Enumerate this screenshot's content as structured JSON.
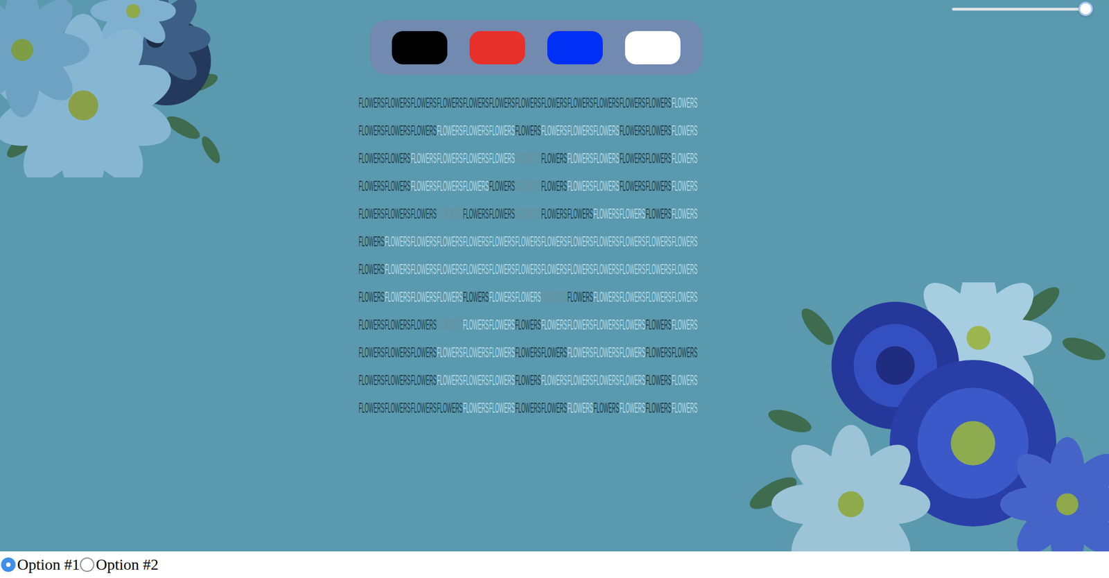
{
  "slider": {
    "level": 1.0
  },
  "palette": {
    "swatches": [
      {
        "color": "#000000"
      },
      {
        "color": "#e8302a"
      },
      {
        "color": "#0030f5"
      },
      {
        "color": "#ffffff"
      }
    ]
  },
  "grid": {
    "rows": [
      {
        "cells": [
          {
            "text": "FLOWERS",
            "color": "#1e3b47"
          },
          {
            "text": "FLOWERS",
            "color": "#1e3b47"
          },
          {
            "text": "FLOWERS",
            "color": "#1e3b47"
          },
          {
            "text": "FLOWERS",
            "color": "#1e3b47"
          },
          {
            "text": "FLOWERS",
            "color": "#1e3b47"
          },
          {
            "text": "FLOWERS",
            "color": "#1e3b47"
          },
          {
            "text": "FLOWERS",
            "color": "#1e3b47"
          },
          {
            "text": "FLOWERS",
            "color": "#1e3b47"
          },
          {
            "text": "FLOWERS",
            "color": "#1e3b47"
          },
          {
            "text": "FLOWERS",
            "color": "#1e3b47"
          },
          {
            "text": "FLOWERS",
            "color": "#1e3b47"
          },
          {
            "text": "FLOWERS",
            "color": "#1e3b47"
          },
          {
            "text": "FLOWERS",
            "color": "#b7dbe6"
          }
        ]
      },
      {
        "cells": [
          {
            "text": "FLOWERS",
            "color": "#1e3b47"
          },
          {
            "text": "FLOWERS",
            "color": "#1e3b47"
          },
          {
            "text": "FLOWERS",
            "color": "#1e3b47"
          },
          {
            "text": "FLOWERS",
            "color": "#b7dbe6"
          },
          {
            "text": "FLOWERS",
            "color": "#b7dbe6"
          },
          {
            "text": "FLOWERS",
            "color": "#b7dbe6"
          },
          {
            "text": "FLOWERS",
            "color": "#1e3b47"
          },
          {
            "text": "FLOWERS",
            "color": "#b7dbe6"
          },
          {
            "text": "FLOWERS",
            "color": "#b7dbe6"
          },
          {
            "text": "FLOWERS",
            "color": "#b7dbe6"
          },
          {
            "text": "FLOWERS",
            "color": "#1e3b47"
          },
          {
            "text": "FLOWERS",
            "color": "#1e3b47"
          },
          {
            "text": "FLOWERS",
            "color": "#b7dbe6"
          }
        ]
      },
      {
        "cells": [
          {
            "text": "FLOWERS",
            "color": "#1e3b47"
          },
          {
            "text": "FLOWERS",
            "color": "#1e3b47"
          },
          {
            "text": "FLOWERS",
            "color": "#b7dbe6"
          },
          {
            "text": "FLOWERS",
            "color": "#b7dbe6"
          },
          {
            "text": "FLOWERS",
            "color": "#b7dbe6"
          },
          {
            "text": "FLOWERS",
            "color": "#b7dbe6"
          },
          {
            "text": "FLOWERS",
            "color": "#6d929e"
          },
          {
            "text": "FLOWERS",
            "color": "#1e3b47"
          },
          {
            "text": "FLOWERS",
            "color": "#b7dbe6"
          },
          {
            "text": "FLOWERS",
            "color": "#b7dbe6"
          },
          {
            "text": "FLOWERS",
            "color": "#1e3b47"
          },
          {
            "text": "FLOWERS",
            "color": "#1e3b47"
          },
          {
            "text": "FLOWERS",
            "color": "#b7dbe6"
          }
        ]
      },
      {
        "cells": [
          {
            "text": "FLOWERS",
            "color": "#1e3b47"
          },
          {
            "text": "FLOWERS",
            "color": "#1e3b47"
          },
          {
            "text": "FLOWERS",
            "color": "#b7dbe6"
          },
          {
            "text": "FLOWERS",
            "color": "#b7dbe6"
          },
          {
            "text": "FLOWERS",
            "color": "#b7dbe6"
          },
          {
            "text": "FLOWERS",
            "color": "#1e3b47"
          },
          {
            "text": "FLOWERS",
            "color": "#6d929e"
          },
          {
            "text": "FLOWERS",
            "color": "#1e3b47"
          },
          {
            "text": "FLOWERS",
            "color": "#b7dbe6"
          },
          {
            "text": "FLOWERS",
            "color": "#b7dbe6"
          },
          {
            "text": "FLOWERS",
            "color": "#1e3b47"
          },
          {
            "text": "FLOWERS",
            "color": "#1e3b47"
          },
          {
            "text": "FLOWERS",
            "color": "#b7dbe6"
          }
        ]
      },
      {
        "cells": [
          {
            "text": "FLOWERS",
            "color": "#1e3b47"
          },
          {
            "text": "FLOWERS",
            "color": "#1e3b47"
          },
          {
            "text": "FLOWERS",
            "color": "#1e3b47"
          },
          {
            "text": "FLOWERS",
            "color": "#6d929e"
          },
          {
            "text": "FLOWERS",
            "color": "#1e3b47"
          },
          {
            "text": "FLOWERS",
            "color": "#1e3b47"
          },
          {
            "text": "FLOWERS",
            "color": "#6d929e"
          },
          {
            "text": "FLOWERS",
            "color": "#1e3b47"
          },
          {
            "text": "FLOWERS",
            "color": "#1e3b47"
          },
          {
            "text": "FLOWERS",
            "color": "#b7dbe6"
          },
          {
            "text": "FLOWERS",
            "color": "#b7dbe6"
          },
          {
            "text": "FLOWERS",
            "color": "#1e3b47"
          },
          {
            "text": "FLOWERS",
            "color": "#b7dbe6"
          }
        ]
      },
      {
        "cells": [
          {
            "text": "FLOWERS",
            "color": "#1e3b47"
          },
          {
            "text": "FLOWERS",
            "color": "#b7dbe6"
          },
          {
            "text": "FLOWERS",
            "color": "#b7dbe6"
          },
          {
            "text": "FLOWERS",
            "color": "#b7dbe6"
          },
          {
            "text": "FLOWERS",
            "color": "#b7dbe6"
          },
          {
            "text": "FLOWERS",
            "color": "#b7dbe6"
          },
          {
            "text": "FLOWERS",
            "color": "#b7dbe6"
          },
          {
            "text": "FLOWERS",
            "color": "#b7dbe6"
          },
          {
            "text": "FLOWERS",
            "color": "#b7dbe6"
          },
          {
            "text": "FLOWERS",
            "color": "#b7dbe6"
          },
          {
            "text": "FLOWERS",
            "color": "#b7dbe6"
          },
          {
            "text": "FLOWERS",
            "color": "#b7dbe6"
          },
          {
            "text": "FLOWERS",
            "color": "#b7dbe6"
          }
        ]
      },
      {
        "cells": [
          {
            "text": "FLOWERS",
            "color": "#1e3b47"
          },
          {
            "text": "FLOWERS",
            "color": "#b7dbe6"
          },
          {
            "text": "FLOWERS",
            "color": "#b7dbe6"
          },
          {
            "text": "FLOWERS",
            "color": "#b7dbe6"
          },
          {
            "text": "FLOWERS",
            "color": "#b7dbe6"
          },
          {
            "text": "FLOWERS",
            "color": "#b7dbe6"
          },
          {
            "text": "FLOWERS",
            "color": "#b7dbe6"
          },
          {
            "text": "FLOWERS",
            "color": "#b7dbe6"
          },
          {
            "text": "FLOWERS",
            "color": "#b7dbe6"
          },
          {
            "text": "FLOWERS",
            "color": "#b7dbe6"
          },
          {
            "text": "FLOWERS",
            "color": "#b7dbe6"
          },
          {
            "text": "FLOWERS",
            "color": "#b7dbe6"
          },
          {
            "text": "FLOWERS",
            "color": "#b7dbe6"
          }
        ]
      },
      {
        "cells": [
          {
            "text": "FLOWERS",
            "color": "#1e3b47"
          },
          {
            "text": "FLOWERS",
            "color": "#b7dbe6"
          },
          {
            "text": "FLOWERS",
            "color": "#b7dbe6"
          },
          {
            "text": "FLOWERS",
            "color": "#b7dbe6"
          },
          {
            "text": "FLOWERS",
            "color": "#1e3b47"
          },
          {
            "text": "FLOWERS",
            "color": "#b7dbe6"
          },
          {
            "text": "FLOWERS",
            "color": "#b7dbe6"
          },
          {
            "text": "FLOWERS",
            "color": "#6d929e"
          },
          {
            "text": "FLOWERS",
            "color": "#1e3b47"
          },
          {
            "text": "FLOWERS",
            "color": "#b7dbe6"
          },
          {
            "text": "FLOWERS",
            "color": "#b7dbe6"
          },
          {
            "text": "FLOWERS",
            "color": "#b7dbe6"
          },
          {
            "text": "FLOWERS",
            "color": "#b7dbe6"
          }
        ]
      },
      {
        "cells": [
          {
            "text": "FLOWERS",
            "color": "#1e3b47"
          },
          {
            "text": "FLOWERS",
            "color": "#1e3b47"
          },
          {
            "text": "FLOWERS",
            "color": "#1e3b47"
          },
          {
            "text": "FLOWERS",
            "color": "#6d929e"
          },
          {
            "text": "FLOWERS",
            "color": "#b7dbe6"
          },
          {
            "text": "FLOWERS",
            "color": "#b7dbe6"
          },
          {
            "text": "FLOWERS",
            "color": "#1e3b47"
          },
          {
            "text": "FLOWERS",
            "color": "#b7dbe6"
          },
          {
            "text": "FLOWERS",
            "color": "#b7dbe6"
          },
          {
            "text": "FLOWERS",
            "color": "#b7dbe6"
          },
          {
            "text": "FLOWERS",
            "color": "#b7dbe6"
          },
          {
            "text": "FLOWERS",
            "color": "#1e3b47"
          },
          {
            "text": "FLOWERS",
            "color": "#b7dbe6"
          }
        ]
      },
      {
        "cells": [
          {
            "text": "FLOWERS",
            "color": "#1e3b47"
          },
          {
            "text": "FLOWERS",
            "color": "#1e3b47"
          },
          {
            "text": "FLOWERS",
            "color": "#1e3b47"
          },
          {
            "text": "FLOWERS",
            "color": "#b7dbe6"
          },
          {
            "text": "FLOWERS",
            "color": "#b7dbe6"
          },
          {
            "text": "FLOWERS",
            "color": "#b7dbe6"
          },
          {
            "text": "FLOWERS",
            "color": "#1e3b47"
          },
          {
            "text": "FLOWERS",
            "color": "#1e3b47"
          },
          {
            "text": "FLOWERS",
            "color": "#b7dbe6"
          },
          {
            "text": "FLOWERS",
            "color": "#b7dbe6"
          },
          {
            "text": "FLOWERS",
            "color": "#b7dbe6"
          },
          {
            "text": "FLOWERS",
            "color": "#1e3b47"
          },
          {
            "text": "FLOWERS",
            "color": "#1e3b47"
          }
        ]
      },
      {
        "cells": [
          {
            "text": "FLOWERS",
            "color": "#1e3b47"
          },
          {
            "text": "FLOWERS",
            "color": "#1e3b47"
          },
          {
            "text": "FLOWERS",
            "color": "#1e3b47"
          },
          {
            "text": "FLOWERS",
            "color": "#b7dbe6"
          },
          {
            "text": "FLOWERS",
            "color": "#b7dbe6"
          },
          {
            "text": "FLOWERS",
            "color": "#b7dbe6"
          },
          {
            "text": "FLOWERS",
            "color": "#1e3b47"
          },
          {
            "text": "FLOWERS",
            "color": "#b7dbe6"
          },
          {
            "text": "FLOWERS",
            "color": "#b7dbe6"
          },
          {
            "text": "FLOWERS",
            "color": "#b7dbe6"
          },
          {
            "text": "FLOWERS",
            "color": "#b7dbe6"
          },
          {
            "text": "FLOWERS",
            "color": "#1e3b47"
          },
          {
            "text": "FLOWERS",
            "color": "#b7dbe6"
          }
        ]
      },
      {
        "cells": [
          {
            "text": "FLOWERS",
            "color": "#1e3b47"
          },
          {
            "text": "FLOWERS",
            "color": "#1e3b47"
          },
          {
            "text": "FLOWERS",
            "color": "#1e3b47"
          },
          {
            "text": "FLOWERS",
            "color": "#1e3b47"
          },
          {
            "text": "FLOWERS",
            "color": "#b7dbe6"
          },
          {
            "text": "FLOWERS",
            "color": "#b7dbe6"
          },
          {
            "text": "FLOWERS",
            "color": "#1e3b47"
          },
          {
            "text": "FLOWERS",
            "color": "#1e3b47"
          },
          {
            "text": "FLOWERS",
            "color": "#b7dbe6"
          },
          {
            "text": "FLOWERS",
            "color": "#1e3b47"
          },
          {
            "text": "FLOWERS",
            "color": "#b7dbe6"
          },
          {
            "text": "FLOWERS",
            "color": "#1e3b47"
          },
          {
            "text": "FLOWERS",
            "color": "#b7dbe6"
          }
        ]
      }
    ]
  },
  "radios": [
    {
      "label": "Option #1",
      "selected": true
    },
    {
      "label": "Option #2",
      "selected": false
    }
  ]
}
